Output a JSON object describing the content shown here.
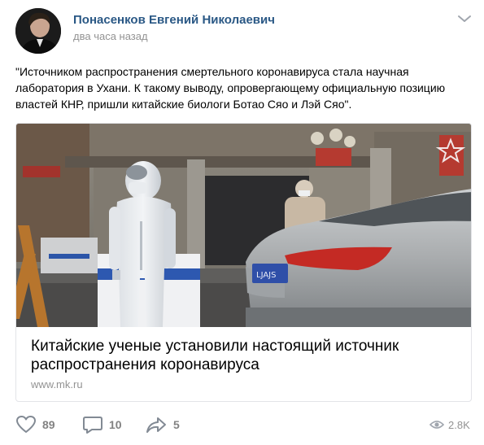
{
  "post": {
    "author": "Понасенков Евгений Николаевич",
    "time": "два часа назад",
    "text": "\"Источником распространения смертельного коронавируса стала научная лаборатория в Ухани. К такому выводу, опровергающему официальную позицию властей КНР, пришли китайские биологи Ботао Сяо и Лэй Сяо\".",
    "attachment": {
      "title": "Китайские ученые установили настоящий источник распространения коронавируса",
      "domain": "www.mk.ru",
      "license_plate": "LJAJS"
    },
    "actions": {
      "likes": "89",
      "comments": "10",
      "shares": "5",
      "views": "2.8K"
    }
  },
  "icons": {
    "menu": "chevron-down-icon",
    "like": "heart-icon",
    "comment": "comment-icon",
    "share": "share-arrow-icon",
    "views": "eye-icon"
  },
  "colors": {
    "author": "#2a5885",
    "meta": "#939393",
    "icon": "#828282"
  }
}
